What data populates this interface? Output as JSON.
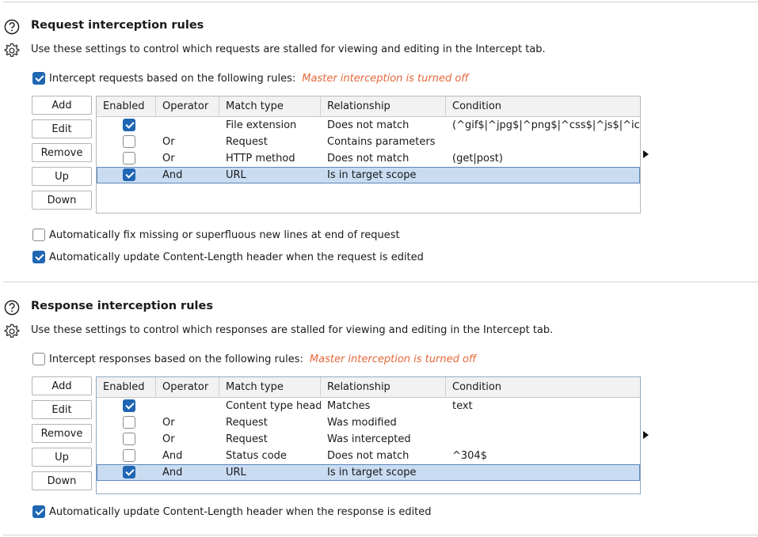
{
  "request": {
    "title": "Request interception rules",
    "description": "Use these settings to control which requests are stalled for viewing and editing in the Intercept tab.",
    "intercept_label": "Intercept requests based on the following rules:",
    "intercept_checked": true,
    "master_note": "Master interception is turned off",
    "buttons": {
      "add": "Add",
      "edit": "Edit",
      "remove": "Remove",
      "up": "Up",
      "down": "Down"
    },
    "columns": [
      "Enabled",
      "Operator",
      "Match type",
      "Relationship",
      "Condition"
    ],
    "rows": [
      {
        "enabled": true,
        "operator": "",
        "match_type": "File extension",
        "relationship": "Does not match",
        "condition": "(^gif$|^jpg$|^png$|^css$|^js$|^ico$|...",
        "selected": false
      },
      {
        "enabled": false,
        "operator": "Or",
        "match_type": "Request",
        "relationship": "Contains parameters",
        "condition": "",
        "selected": false
      },
      {
        "enabled": false,
        "operator": "Or",
        "match_type": "HTTP method",
        "relationship": "Does not match",
        "condition": "(get|post)",
        "selected": false
      },
      {
        "enabled": true,
        "operator": "And",
        "match_type": "URL",
        "relationship": "Is in target scope",
        "condition": "",
        "selected": true
      }
    ],
    "opt_fix_newlines": {
      "label": "Automatically fix missing or superfluous new lines at end of request",
      "checked": false
    },
    "opt_update_length": {
      "label": "Automatically update Content-Length header when the request is edited",
      "checked": true
    }
  },
  "response": {
    "title": "Response interception rules",
    "description": "Use these settings to control which responses are stalled for viewing and editing in the Intercept tab.",
    "intercept_label": "Intercept responses based on the following rules:",
    "intercept_checked": false,
    "master_note": "Master interception is turned off",
    "buttons": {
      "add": "Add",
      "edit": "Edit",
      "remove": "Remove",
      "up": "Up",
      "down": "Down"
    },
    "columns": [
      "Enabled",
      "Operator",
      "Match type",
      "Relationship",
      "Condition"
    ],
    "rows": [
      {
        "enabled": true,
        "operator": "",
        "match_type": "Content type head...",
        "relationship": "Matches",
        "condition": "text",
        "selected": false
      },
      {
        "enabled": false,
        "operator": "Or",
        "match_type": "Request",
        "relationship": "Was modified",
        "condition": "",
        "selected": false
      },
      {
        "enabled": false,
        "operator": "Or",
        "match_type": "Request",
        "relationship": "Was intercepted",
        "condition": "",
        "selected": false
      },
      {
        "enabled": false,
        "operator": "And",
        "match_type": "Status code",
        "relationship": "Does not match",
        "condition": "^304$",
        "selected": false
      },
      {
        "enabled": true,
        "operator": "And",
        "match_type": "URL",
        "relationship": "Is in target scope",
        "condition": "",
        "selected": true
      }
    ],
    "opt_update_length": {
      "label": "Automatically update Content-Length header when the response is edited",
      "checked": true
    }
  },
  "colors": {
    "accent": "#1f66b3",
    "warning": "#e5683a",
    "selection": "#c9dcf2"
  },
  "icons": {
    "help": "help-circle-icon",
    "settings": "gear-icon",
    "expand": "arrow-right-icon"
  }
}
